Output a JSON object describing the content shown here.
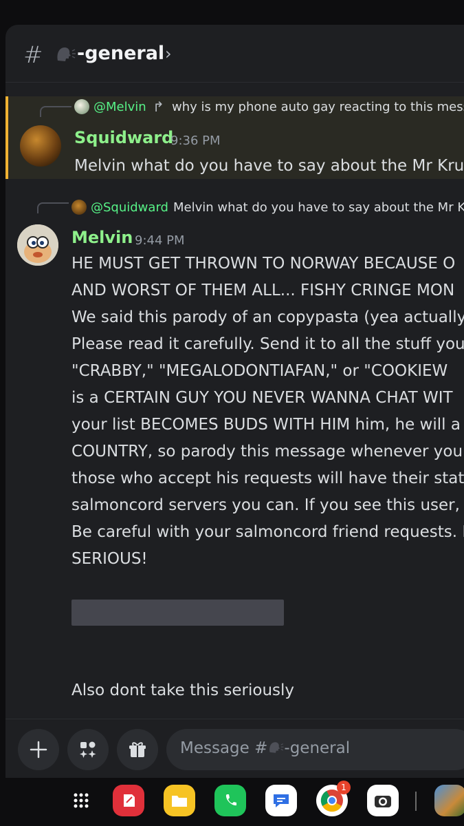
{
  "header": {
    "hash": "#",
    "channel_name": "-general",
    "chevron": "›"
  },
  "messages": [
    {
      "reply": {
        "name": "@Melvin",
        "text": "why is my phone auto gay reacting to this message"
      },
      "author": "Squidward",
      "time": "9:36 PM",
      "lines": [
        "Melvin what do you have to say about the Mr Krup"
      ]
    },
    {
      "reply": {
        "name": "@Squidward",
        "text": "Melvin what do you have to say about the Mr Krup"
      },
      "author": "Melvin",
      "time": "9:44 PM",
      "lines": [
        "HE MUST GET THROWN TO NORWAY BECAUSE O",
        "AND WORST OF THEM ALL... FISHY CRINGE MON",
        "We said this parody of an copypasta (yea actually)",
        "Please read it carefully. Send it to all the stuff you'",
        "\"CRABBY,\" \"MEGALODONTIAFAN,\" or \"COOKIEW",
        "is a CERTAIN GUY YOU NEVER WANNA CHAT WIT",
        "your list BECOMES BUDS WITH HIM him, he will a",
        "COUNTRY, so parody this message whenever you c",
        "those who accept his requests will have their state",
        "salmoncord servers you can. If you see this user, D",
        "Be careful with your salmoncord friend requests. P",
        "SERIOUS!"
      ],
      "footer": "Also dont take this seriously"
    }
  ],
  "composer": {
    "placeholder": "Message #",
    "placeholder_channel": "-general"
  },
  "dock": {
    "apps": [
      "apps-grid-icon",
      "notes-app-icon",
      "files-app-icon",
      "phone-app-icon",
      "messages-app-icon",
      "chrome-app-icon",
      "camera-app-icon",
      "gallery-app-icon"
    ],
    "chrome_badge": "1"
  },
  "colors": {
    "username": "#8ef08b",
    "mention": "#57f287",
    "highlight_bar": "#f0b232",
    "background": "#1e1f22"
  }
}
